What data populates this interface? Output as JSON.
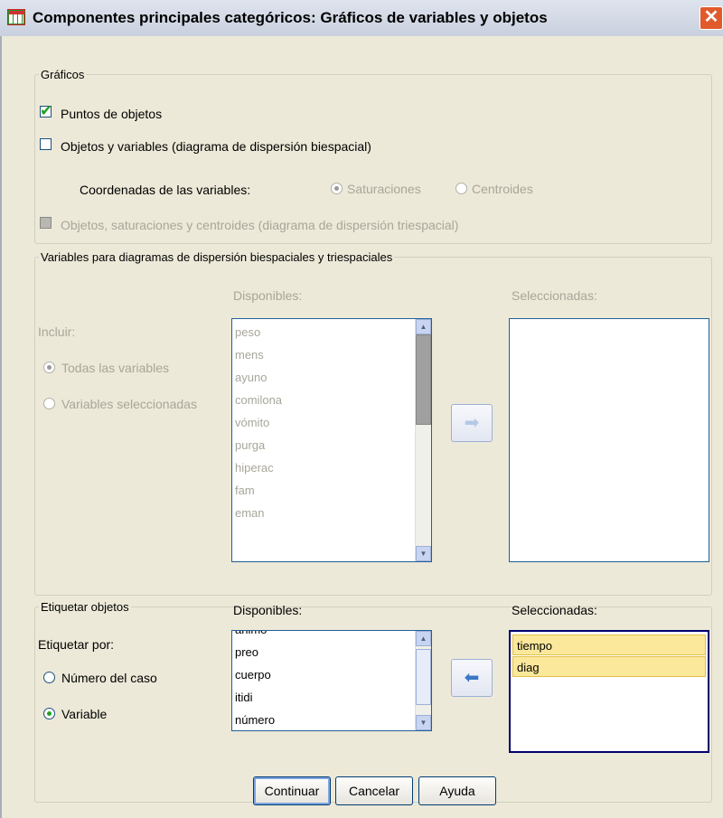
{
  "window": {
    "title": "Componentes principales categóricos: Gráficos de variables y objetos",
    "close_glyph": "✕"
  },
  "graficos": {
    "legend": "Gráficos",
    "puntos_objetos": "Puntos de objetos",
    "objetos_variables": "Objetos y variables (diagrama de dispersión biespacial)",
    "coordenadas_label": "Coordenadas de las variables:",
    "saturaciones": "Saturaciones",
    "centroides": "Centroides",
    "triespacial": "Objetos, saturaciones y centroides (diagrama de dispersión triespacial)"
  },
  "variables_section": {
    "legend": "Variables para diagramas de dispersión biespaciales y triespaciales",
    "disponibles_label": "Disponibles:",
    "seleccionadas_label": "Seleccionadas:",
    "incluir_label": "Incluir:",
    "todas": "Todas las variables",
    "seleccionadas_radio": "Variables seleccionadas",
    "items": [
      "peso",
      "mens",
      "ayuno",
      "comilona",
      "vómito",
      "purga",
      "hiperac",
      "fam",
      "eman"
    ],
    "arrow_glyph": "➡"
  },
  "etiquetar": {
    "legend": "Etiquetar objetos",
    "disponibles_label": "Disponibles:",
    "seleccionadas_label": "Seleccionadas:",
    "etiquetar_por": "Etiquetar por:",
    "numero_caso": "Número del caso",
    "variable": "Variable",
    "items": [
      "ánimo",
      "preo",
      "cuerpo",
      "itidi",
      "número"
    ],
    "selected_items": [
      "tiempo",
      "diag"
    ],
    "arrow_glyph": "⬅"
  },
  "buttons": {
    "continuar": "Continuar",
    "cancelar": "Cancelar",
    "ayuda": "Ayuda"
  },
  "scroll_glyphs": {
    "up": "▲",
    "down": "▼"
  }
}
